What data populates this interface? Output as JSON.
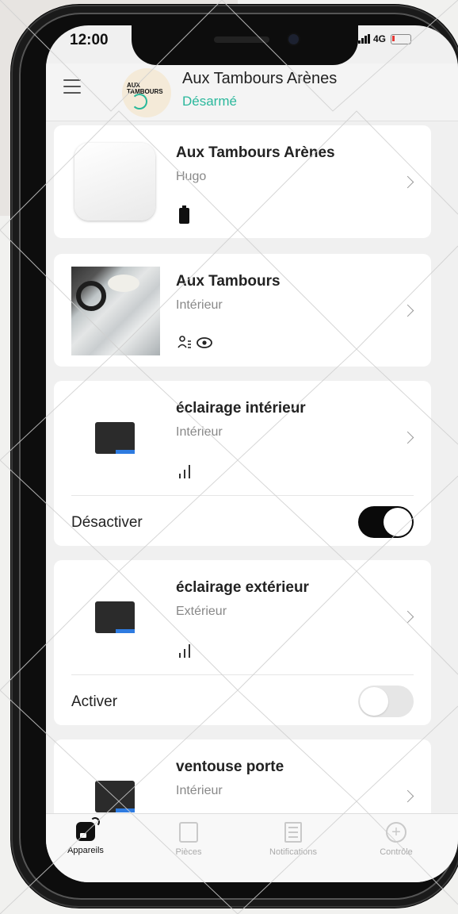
{
  "status_bar": {
    "time": "12:00",
    "network": "4G"
  },
  "header": {
    "logo_text": "AUX TAMBOURS",
    "hub_name": "Aux Tambours Arènes",
    "arm_status": "Désarmé"
  },
  "devices": [
    {
      "name": "Aux Tambours Arènes",
      "room": "Hugo",
      "type": "hub"
    },
    {
      "name": "Aux Tambours",
      "room": "Intérieur",
      "type": "camera",
      "icons": "ὂ5 👁"
    },
    {
      "name": "éclairage intérieur",
      "room": "Intérieur",
      "type": "relay",
      "action_label": "Désactiver",
      "switch_on": true
    },
    {
      "name": "éclairage extérieur",
      "room": "Extérieur",
      "type": "relay",
      "action_label": "Activer",
      "switch_on": false
    },
    {
      "name": "ventouse porte",
      "room": "Intérieur",
      "type": "relay"
    }
  ],
  "tabs": [
    {
      "label": "Appareils",
      "icon": "devices-icon",
      "active": true
    },
    {
      "label": "Pièces",
      "icon": "rooms-icon",
      "active": false
    },
    {
      "label": "Notifications",
      "icon": "notifications-icon",
      "active": false
    },
    {
      "label": "Contrôle",
      "icon": "control-icon",
      "active": false
    }
  ],
  "colors": {
    "accent_green": "#2bb89c",
    "switch_on": "#0a0a0a",
    "switch_off": "#e6e6e6"
  }
}
